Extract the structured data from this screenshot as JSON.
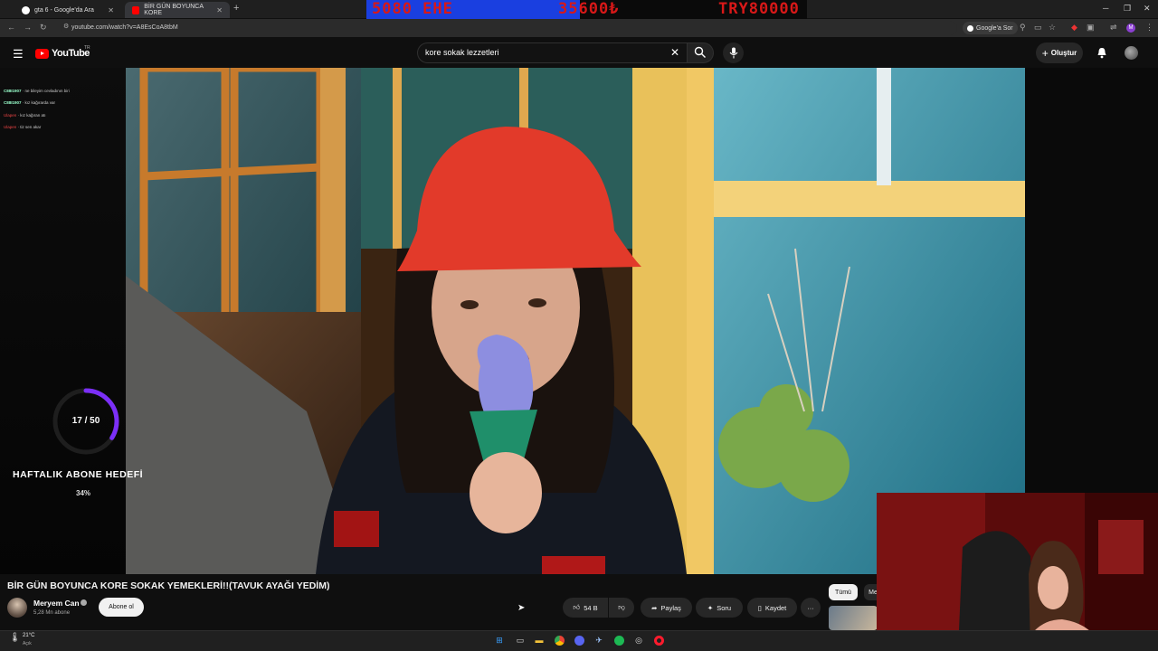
{
  "browser": {
    "tabs": [
      {
        "title": "gta 6 - Google'da Ara",
        "active": false,
        "favicon": "google-icon"
      },
      {
        "title": "BİR GÜN BOYUNCA KORE",
        "active": true,
        "favicon": "youtube-icon"
      }
    ],
    "url": "youtube.com/watch?v=A8EsCoA8tbM",
    "google_ask_label": "Google'a Sor"
  },
  "stream_overlay": {
    "left_text": "5080 EHE",
    "middle_text": "35600₺",
    "right_text": "TRY80000",
    "colors": {
      "text": "#d81818",
      "bar": "#1a3fe0"
    }
  },
  "youtube": {
    "logo_text": "YouTube",
    "country_code": "TR",
    "search": {
      "value": "kore sokak lezzetleri"
    },
    "create_label": "Oluştur"
  },
  "chat": [
    {
      "user": "C88I1907",
      "message": "ne bileyim cevladının biri"
    },
    {
      "user": "C88I1907",
      "message": "kız kağırarda var"
    },
    {
      "user": "Ulapen",
      "message": "kız kağıran atı"
    },
    {
      "user": "Ulapen",
      "message": "tiz sen akar"
    }
  ],
  "subscriber_goal": {
    "count_text": "17 / 50",
    "current": 17,
    "target": 50,
    "title": "HAFTALIK ABONE HEDEFİ",
    "percent_text": "34%",
    "ring_color": "#7b2ff7"
  },
  "video": {
    "title": "BİR GÜN BOYUNCA KORE SOKAK YEMEKLERİ!!(TAVUK AYAĞI YEDİM)",
    "channel": "Meryem Can",
    "subscribers": "5,28 Mn abone",
    "subscribe_label": "Abone ol",
    "likes": "54 B",
    "share_label": "Paylaş",
    "ask_label": "Soru",
    "save_label": "Kaydet"
  },
  "recommendation_chips": {
    "all_label": "Tümü",
    "next_label": "Me"
  },
  "taskbar": {
    "temperature": "21°C",
    "weather": "Açık",
    "apps": [
      "windows-start-icon",
      "search-icon",
      "file-explorer-icon",
      "chrome-icon",
      "discord-icon",
      "steam-icon",
      "spotify-icon",
      "obs-icon",
      "opera-icon"
    ]
  }
}
